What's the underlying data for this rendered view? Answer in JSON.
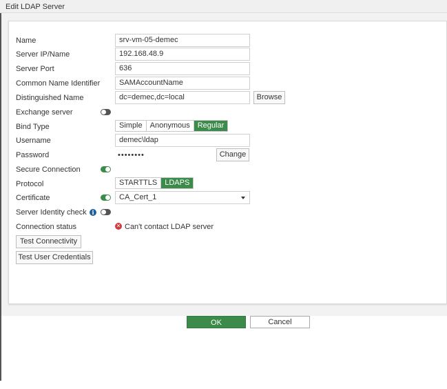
{
  "window": {
    "title": "Edit LDAP Server"
  },
  "form": {
    "name": {
      "label": "Name",
      "value": "srv-vm-05-demec"
    },
    "server_ip": {
      "label": "Server IP/Name",
      "value": "192.168.48.9"
    },
    "server_port": {
      "label": "Server Port",
      "value": "636"
    },
    "cn_identifier": {
      "label": "Common Name Identifier",
      "value": "SAMAccountName"
    },
    "distinguished_name": {
      "label": "Distinguished Name",
      "value": "dc=demec,dc=local",
      "browse_label": "Browse"
    },
    "exchange_server": {
      "label": "Exchange server",
      "enabled": false
    },
    "bind_type": {
      "label": "Bind Type",
      "options": [
        "Simple",
        "Anonymous",
        "Regular"
      ],
      "selected": "Regular"
    },
    "username": {
      "label": "Username",
      "value": "demec\\ldap"
    },
    "password": {
      "label": "Password",
      "value": "••••••••",
      "change_label": "Change"
    },
    "secure_connection": {
      "label": "Secure Connection",
      "enabled": true
    },
    "protocol": {
      "label": "Protocol",
      "options": [
        "STARTTLS",
        "LDAPS"
      ],
      "selected": "LDAPS"
    },
    "certificate": {
      "label": "Certificate",
      "enabled": true,
      "value": "CA_Cert_1"
    },
    "server_identity_check": {
      "label": "Server Identity check",
      "enabled": false
    },
    "connection_status": {
      "label": "Connection status",
      "value": "Can't contact LDAP server"
    },
    "test_connectivity_label": "Test Connectivity",
    "test_credentials_label": "Test User Credentials"
  },
  "footer": {
    "ok_label": "OK",
    "cancel_label": "Cancel"
  },
  "colors": {
    "accent": "#3d8b4b",
    "error": "#d13a3a",
    "info": "#1f5f9a"
  },
  "icons": {
    "error": "x-circle-icon",
    "info": "info-icon",
    "dropdown": "caret-down-icon"
  }
}
